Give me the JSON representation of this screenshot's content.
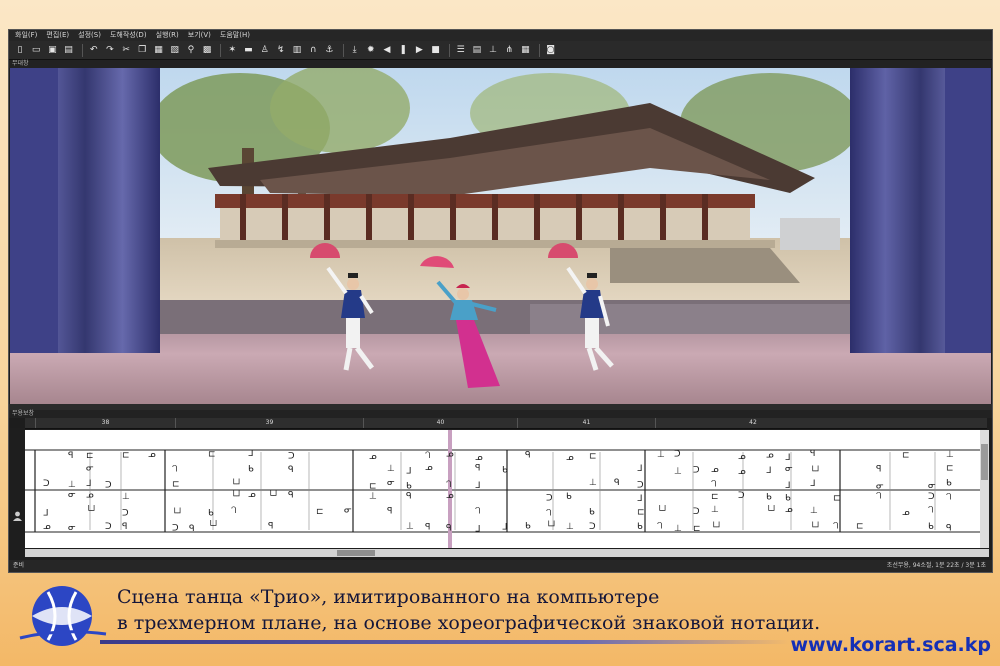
{
  "app": {
    "menu": [
      "화일(F)",
      "편집(E)",
      "설정(S)",
      "도해작성(D)",
      "실행(R)",
      "보기(V)",
      "도움말(H)"
    ],
    "toolbar_icons": [
      "new-file-icon",
      "open-folder-icon",
      "save-icon",
      "save-as-icon",
      "sep",
      "undo-icon",
      "redo-icon",
      "cut-icon",
      "copy-icon",
      "paste-icon",
      "clone-icon",
      "zoom-icon",
      "frame-icon",
      "sep",
      "dancer-pose-icon",
      "keyframe-icon",
      "figure-icon",
      "motion-icon",
      "script-icon",
      "loop-icon",
      "anchor-icon",
      "sep",
      "download-icon",
      "settings-icon",
      "rewind-icon",
      "pause-icon",
      "fast-forward-icon",
      "stop-icon",
      "sep",
      "staff-lines-icon",
      "score-icon",
      "notation-icon",
      "symbol-icon",
      "grid-icon",
      "sep",
      "camera-icon"
    ],
    "stage_pane_title": "무대창",
    "score_pane_title": "무용보창",
    "measure_numbers": [
      "38",
      "39",
      "40",
      "41",
      "42"
    ],
    "status_left": "준비",
    "status_right": "조선무용, 94소절,    1분 22초 / 3분 1초"
  },
  "caption": {
    "line1": "Сцена танца «Трио», имитированного на компьютере",
    "line2": "в трехмерном плане, на основе хореографической знаковой нотации."
  },
  "website": "www.korart.sca.kp",
  "colors": {
    "background_top": "#fbe7c6",
    "background_bottom": "#f3b867",
    "curtain": "#3b3d7a",
    "caption_text": "#14163a",
    "website_text": "#1530b6",
    "playhead": "#c8a0c0"
  }
}
